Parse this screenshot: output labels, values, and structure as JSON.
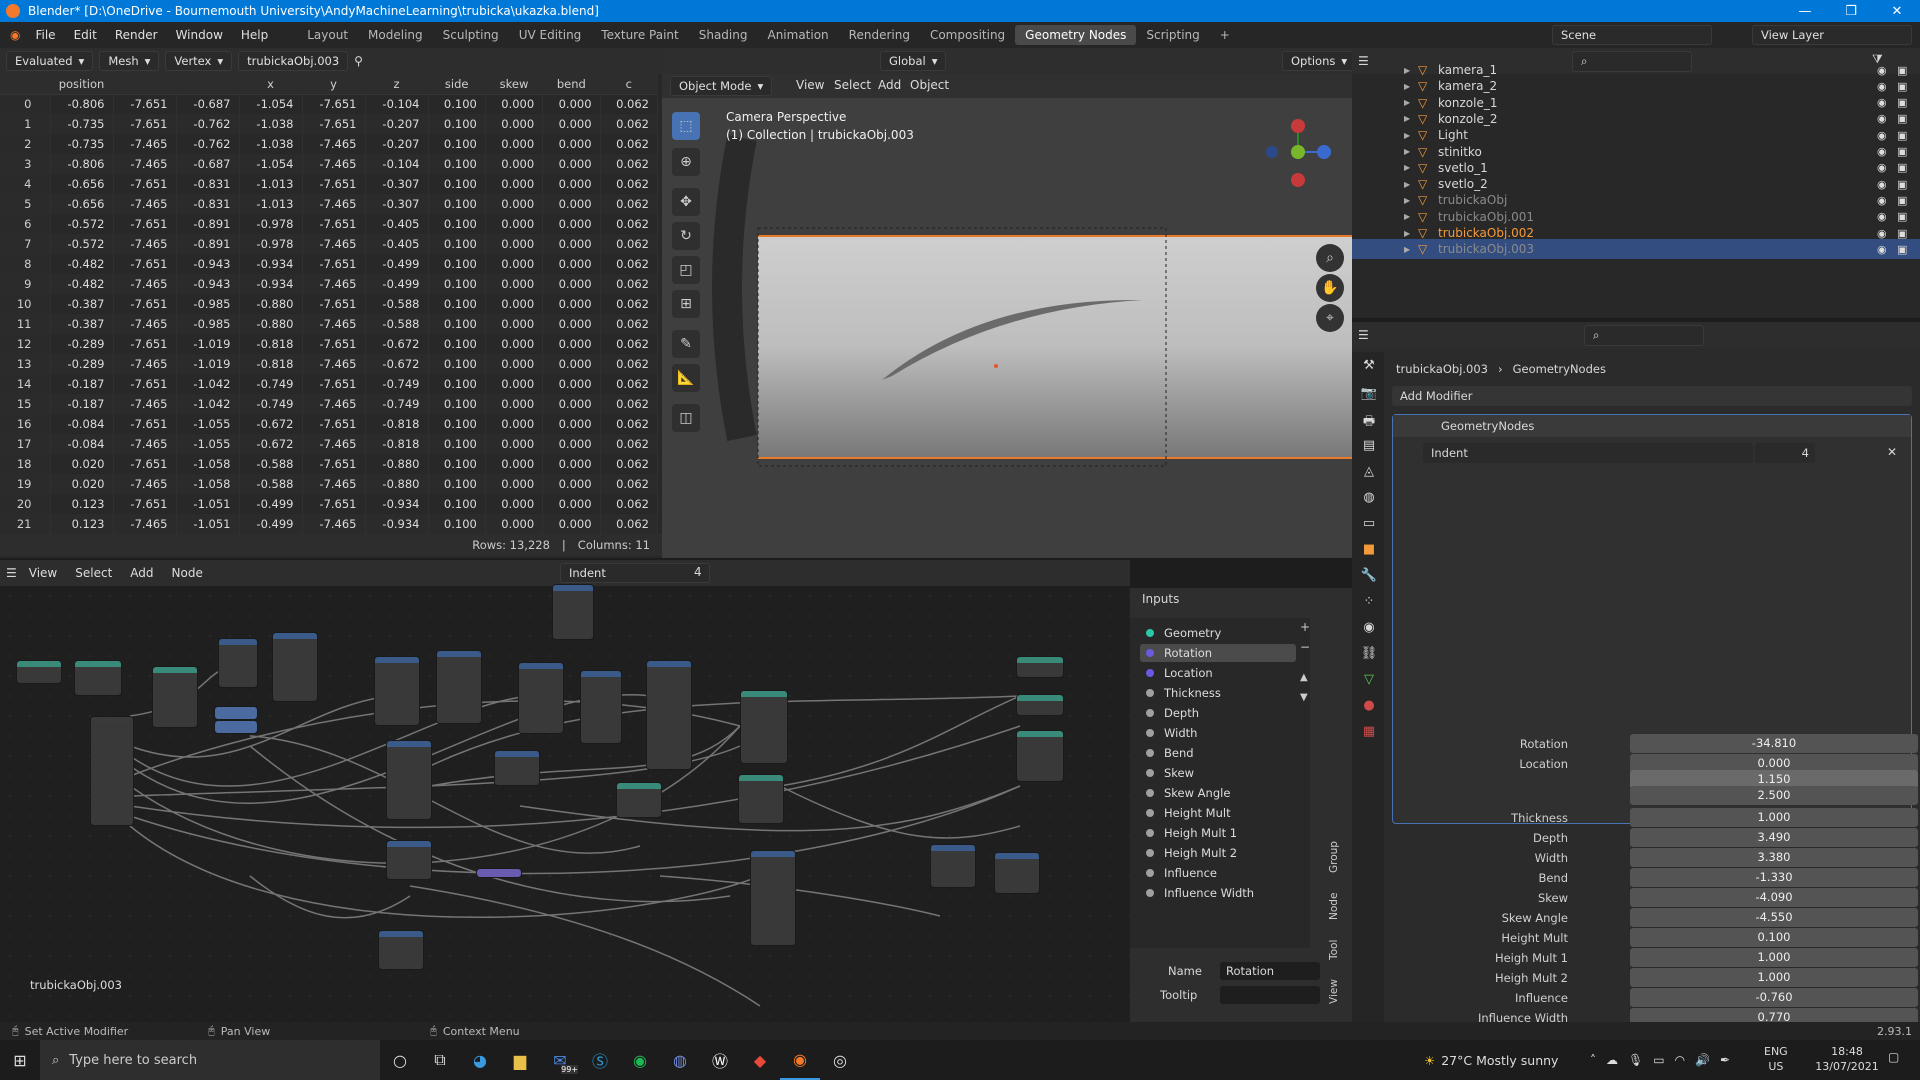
{
  "window": {
    "title": "Blender* [D:\\OneDrive - Bournemouth University\\AndyMachineLearning\\trubicka\\ukazka.blend]",
    "minimize": "—",
    "maximize": "❐",
    "close": "✕"
  },
  "menu": {
    "items": [
      "File",
      "Edit",
      "Render",
      "Window",
      "Help"
    ],
    "workspaces": [
      "Layout",
      "Modeling",
      "Sculpting",
      "UV Editing",
      "Texture Paint",
      "Shading",
      "Animation",
      "Rendering",
      "Compositing",
      "Geometry Nodes",
      "Scripting"
    ],
    "active_workspace": "Geometry Nodes",
    "scene": "Scene",
    "view_layer": "View Layer"
  },
  "spreadsheet": {
    "header": {
      "mode": "Evaluated",
      "component": "Mesh",
      "domain": "Vertex",
      "object": "trubickaObj.003"
    },
    "columns": [
      "",
      "position",
      "",
      "",
      "x",
      "y",
      "z",
      "side",
      "skew",
      "bend",
      "c"
    ],
    "rows": [
      [
        "0",
        "-0.806",
        "-7.651",
        "-0.687",
        "-1.054",
        "-7.651",
        "-0.104",
        "0.100",
        "0.000",
        "0.000",
        "0.062"
      ],
      [
        "1",
        "-0.735",
        "-7.651",
        "-0.762",
        "-1.038",
        "-7.651",
        "-0.207",
        "0.100",
        "0.000",
        "0.000",
        "0.062"
      ],
      [
        "2",
        "-0.735",
        "-7.465",
        "-0.762",
        "-1.038",
        "-7.465",
        "-0.207",
        "0.100",
        "0.000",
        "0.000",
        "0.062"
      ],
      [
        "3",
        "-0.806",
        "-7.465",
        "-0.687",
        "-1.054",
        "-7.465",
        "-0.104",
        "0.100",
        "0.000",
        "0.000",
        "0.062"
      ],
      [
        "4",
        "-0.656",
        "-7.651",
        "-0.831",
        "-1.013",
        "-7.651",
        "-0.307",
        "0.100",
        "0.000",
        "0.000",
        "0.062"
      ],
      [
        "5",
        "-0.656",
        "-7.465",
        "-0.831",
        "-1.013",
        "-7.465",
        "-0.307",
        "0.100",
        "0.000",
        "0.000",
        "0.062"
      ],
      [
        "6",
        "-0.572",
        "-7.651",
        "-0.891",
        "-0.978",
        "-7.651",
        "-0.405",
        "0.100",
        "0.000",
        "0.000",
        "0.062"
      ],
      [
        "7",
        "-0.572",
        "-7.465",
        "-0.891",
        "-0.978",
        "-7.465",
        "-0.405",
        "0.100",
        "0.000",
        "0.000",
        "0.062"
      ],
      [
        "8",
        "-0.482",
        "-7.651",
        "-0.943",
        "-0.934",
        "-7.651",
        "-0.499",
        "0.100",
        "0.000",
        "0.000",
        "0.062"
      ],
      [
        "9",
        "-0.482",
        "-7.465",
        "-0.943",
        "-0.934",
        "-7.465",
        "-0.499",
        "0.100",
        "0.000",
        "0.000",
        "0.062"
      ],
      [
        "10",
        "-0.387",
        "-7.651",
        "-0.985",
        "-0.880",
        "-7.651",
        "-0.588",
        "0.100",
        "0.000",
        "0.000",
        "0.062"
      ],
      [
        "11",
        "-0.387",
        "-7.465",
        "-0.985",
        "-0.880",
        "-7.465",
        "-0.588",
        "0.100",
        "0.000",
        "0.000",
        "0.062"
      ],
      [
        "12",
        "-0.289",
        "-7.651",
        "-1.019",
        "-0.818",
        "-7.651",
        "-0.672",
        "0.100",
        "0.000",
        "0.000",
        "0.062"
      ],
      [
        "13",
        "-0.289",
        "-7.465",
        "-1.019",
        "-0.818",
        "-7.465",
        "-0.672",
        "0.100",
        "0.000",
        "0.000",
        "0.062"
      ],
      [
        "14",
        "-0.187",
        "-7.651",
        "-1.042",
        "-0.749",
        "-7.651",
        "-0.749",
        "0.100",
        "0.000",
        "0.000",
        "0.062"
      ],
      [
        "15",
        "-0.187",
        "-7.465",
        "-1.042",
        "-0.749",
        "-7.465",
        "-0.749",
        "0.100",
        "0.000",
        "0.000",
        "0.062"
      ],
      [
        "16",
        "-0.084",
        "-7.651",
        "-1.055",
        "-0.672",
        "-7.651",
        "-0.818",
        "0.100",
        "0.000",
        "0.000",
        "0.062"
      ],
      [
        "17",
        "-0.084",
        "-7.465",
        "-1.055",
        "-0.672",
        "-7.465",
        "-0.818",
        "0.100",
        "0.000",
        "0.000",
        "0.062"
      ],
      [
        "18",
        "0.020",
        "-7.651",
        "-1.058",
        "-0.588",
        "-7.651",
        "-0.880",
        "0.100",
        "0.000",
        "0.000",
        "0.062"
      ],
      [
        "19",
        "0.020",
        "-7.465",
        "-1.058",
        "-0.588",
        "-7.465",
        "-0.880",
        "0.100",
        "0.000",
        "0.000",
        "0.062"
      ],
      [
        "20",
        "0.123",
        "-7.651",
        "-1.051",
        "-0.499",
        "-7.651",
        "-0.934",
        "0.100",
        "0.000",
        "0.000",
        "0.062"
      ],
      [
        "21",
        "0.123",
        "-7.465",
        "-1.051",
        "-0.499",
        "-7.465",
        "-0.934",
        "0.100",
        "0.000",
        "0.000",
        "0.062"
      ]
    ],
    "footer": {
      "rows": "Rows: 13,228",
      "columns": "Columns: 11"
    }
  },
  "viewport": {
    "mode": "Object Mode",
    "menus": [
      "View",
      "Select",
      "Add",
      "Object"
    ],
    "transform": "Global",
    "options": "Options",
    "camera_label": "Camera Perspective",
    "collection_label": "(1) Collection | trubickaObj.003"
  },
  "outliner": {
    "items": [
      {
        "name": "kamera_1",
        "color": "#d8d8d8"
      },
      {
        "name": "kamera_2",
        "color": "#d8d8d8"
      },
      {
        "name": "konzole_1",
        "color": "#d8d8d8"
      },
      {
        "name": "konzole_2",
        "color": "#d8d8d8"
      },
      {
        "name": "Light",
        "color": "#d8d8d8"
      },
      {
        "name": "stinitko",
        "color": "#d8d8d8"
      },
      {
        "name": "svetlo_1",
        "color": "#d8d8d8"
      },
      {
        "name": "svetlo_2",
        "color": "#d8d8d8"
      },
      {
        "name": "trubickaObj",
        "color": "#8a8a8a"
      },
      {
        "name": "trubickaObj.001",
        "color": "#8a8a8a"
      },
      {
        "name": "trubickaObj.002",
        "color": "#f59a3a"
      },
      {
        "name": "trubickaObj.003",
        "color": "#8a8a8a"
      }
    ]
  },
  "properties": {
    "breadcrumb_object": "trubickaObj.003",
    "breadcrumb_modifier": "GeometryNodes",
    "add_modifier": "Add Modifier",
    "modifier_name": "GeometryNodes",
    "node_group": "Indent",
    "users": "4",
    "fields": [
      {
        "label": "Rotation",
        "value": "-34.810"
      },
      {
        "label": "Location",
        "value": "0.000"
      },
      {
        "label": "",
        "value": "1.150"
      },
      {
        "label": "",
        "value": "2.500"
      },
      {
        "label": "Thickness",
        "value": "1.000"
      },
      {
        "label": "Depth",
        "value": "3.490"
      },
      {
        "label": "Width",
        "value": "3.380"
      },
      {
        "label": "Bend",
        "value": "-1.330"
      },
      {
        "label": "Skew",
        "value": "-4.090"
      },
      {
        "label": "Skew Angle",
        "value": "-4.550"
      },
      {
        "label": "Height Mult",
        "value": "0.100"
      },
      {
        "label": "Heigh Mult 1",
        "value": "1.000"
      },
      {
        "label": "Heigh Mult 2",
        "value": "1.000"
      },
      {
        "label": "Influence",
        "value": "-0.760"
      },
      {
        "label": "Influence Width",
        "value": "0.770"
      }
    ]
  },
  "node_editor": {
    "menus": [
      "View",
      "Select",
      "Add",
      "Node"
    ],
    "node_group": "Indent",
    "users": "4",
    "object_label": "trubickaObj.003"
  },
  "inputs_panel": {
    "title": "Inputs",
    "items": [
      "Geometry",
      "Rotation",
      "Location",
      "Thickness",
      "Depth",
      "Width",
      "Bend",
      "Skew",
      "Skew Angle",
      "Height Mult",
      "Heigh Mult 1",
      "Heigh Mult 2",
      "Influence",
      "Influence Width"
    ],
    "selected": "Rotation",
    "name_label": "Name",
    "name_value": "Rotation",
    "tooltip_label": "Tooltip",
    "side_tabs": [
      "Group",
      "Node",
      "Tool",
      "View"
    ]
  },
  "statusbar": {
    "left": "Set Active Modifier",
    "middle": "Pan View",
    "right": "Context Menu",
    "version": "2.93.1"
  },
  "taskbar": {
    "search": "Type here to search",
    "weather": "27°C  Mostly sunny",
    "lang": "ENG",
    "region": "US",
    "time": "18:48",
    "date": "13/07/2021",
    "mail_badge": "99+"
  }
}
